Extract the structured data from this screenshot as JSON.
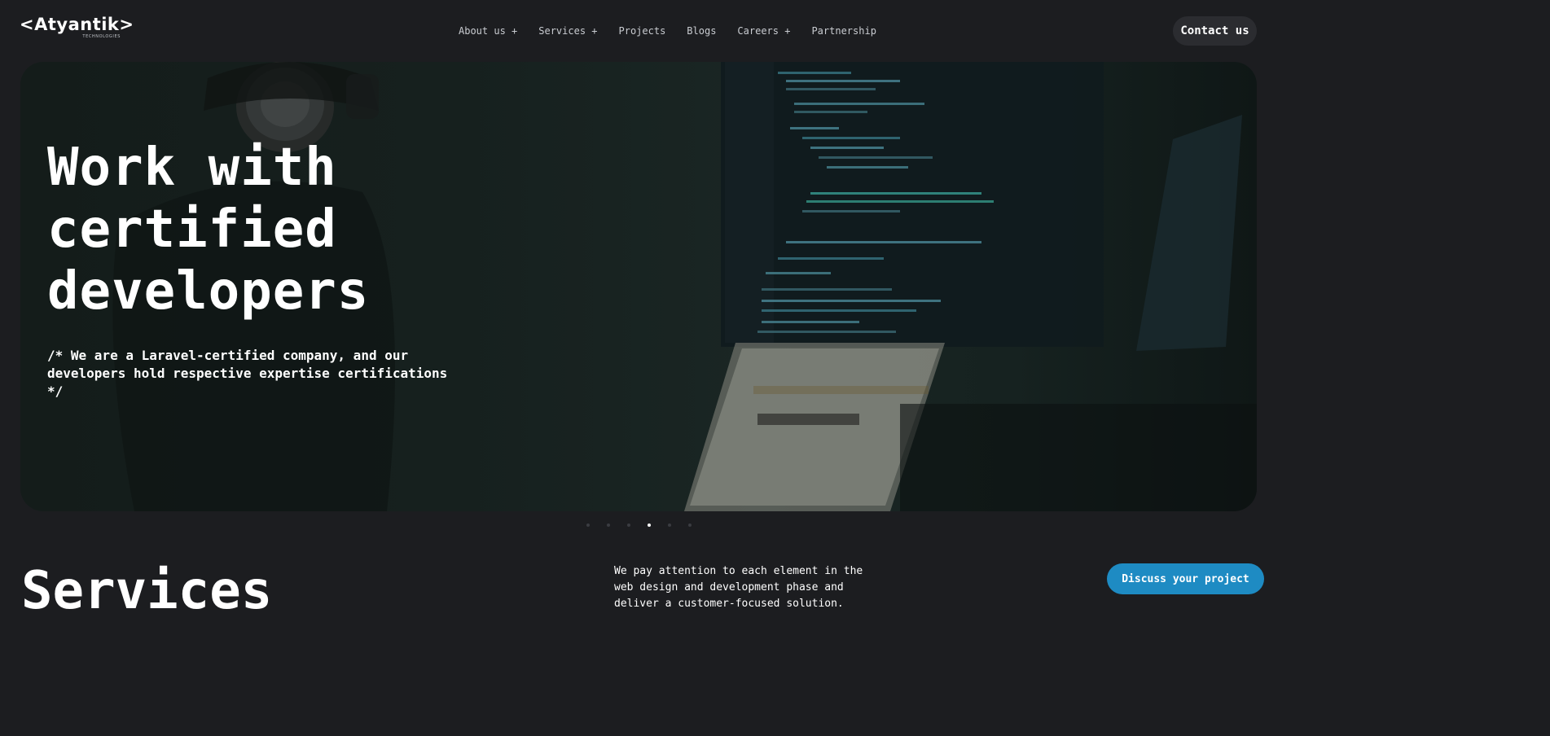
{
  "header": {
    "logo_text": "<Atyantik>",
    "logo_subtext": "TECHNOLOGIES",
    "nav_items": [
      "About us +",
      "Services +",
      "Projects",
      "Blogs",
      "Careers +",
      "Partnership"
    ],
    "contact_label": "Contact us"
  },
  "hero": {
    "title": "Work with certified developers",
    "subtitle": "/* We are a Laravel-certified company, and our developers hold respective expertise certifications */",
    "carousel_active_index": 3,
    "carousel_count": 6
  },
  "services": {
    "title": "Services",
    "description": "We pay attention to each element in the web design and development phase and deliver a customer-focused solution."
  },
  "cta": {
    "discuss_label": "Discuss your project"
  },
  "colors": {
    "background": "#1c1d20",
    "accent": "#1e8bc3",
    "hero_overlay": "#16201e"
  }
}
